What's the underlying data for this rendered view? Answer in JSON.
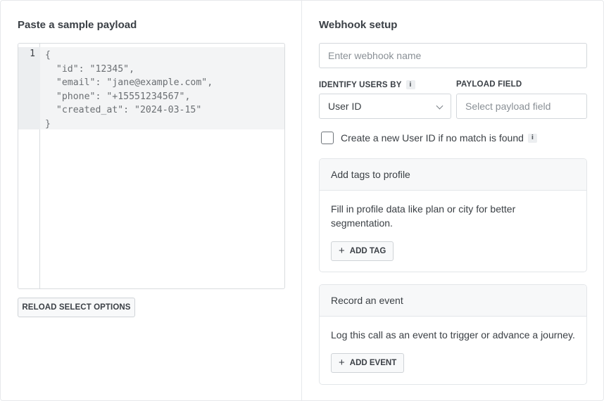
{
  "left": {
    "title": "Paste a sample payload",
    "editor": {
      "line_number": "1",
      "code": "{\n  \"id\": \"12345\",\n  \"email\": \"jane@example.com\",\n  \"phone\": \"+15551234567\",\n  \"created_at\": \"2024-03-15\"\n}"
    },
    "reload_button": "RELOAD SELECT OPTIONS"
  },
  "right": {
    "title": "Webhook setup",
    "webhook_name": {
      "placeholder": "Enter webhook name",
      "value": ""
    },
    "identify_label": "IDENTIFY USERS BY",
    "identify_select": {
      "selected": "User ID"
    },
    "payload_label": "PAYLOAD FIELD",
    "payload_field": {
      "placeholder": "Select payload field"
    },
    "create_checkbox": {
      "label": "Create a new User ID if no match is found",
      "checked": false
    },
    "info_glyph": "i",
    "tags_card": {
      "header": "Add tags to profile",
      "description": "Fill in profile data like plan or city for better segmentation.",
      "button": "ADD TAG"
    },
    "event_card": {
      "header": "Record an event",
      "description": "Log this call as an event to trigger or advance a journey.",
      "button": "ADD EVENT"
    },
    "plus_glyph": "+"
  }
}
